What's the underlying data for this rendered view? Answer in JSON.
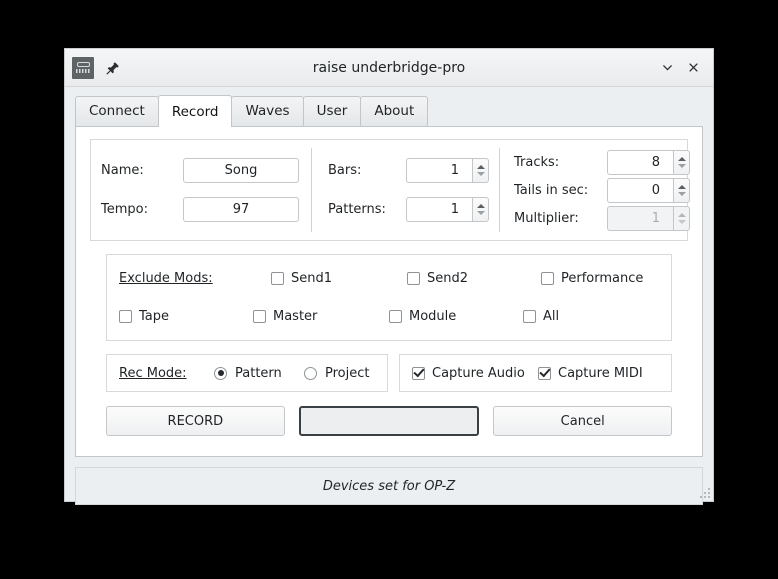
{
  "window": {
    "title": "raise underbridge-pro",
    "app_icon": "opz-device-icon",
    "pin_icon": "pin-icon",
    "minimize_icon": "chevron-down-icon",
    "close_icon": "close-icon"
  },
  "tabs": [
    {
      "label": "Connect",
      "active": false
    },
    {
      "label": "Record",
      "active": true
    },
    {
      "label": "Waves",
      "active": false
    },
    {
      "label": "User",
      "active": false
    },
    {
      "label": "About",
      "active": false
    }
  ],
  "fields": {
    "name": {
      "label": "Name:",
      "value": "Song"
    },
    "tempo": {
      "label": "Tempo:",
      "value": "97"
    },
    "bars": {
      "label": "Bars:",
      "value": "1"
    },
    "patterns": {
      "label": "Patterns:",
      "value": "1"
    },
    "tracks": {
      "label": "Tracks:",
      "value": "8"
    },
    "tails": {
      "label": "Tails in sec:",
      "value": "0"
    },
    "multiplier": {
      "label": "Multiplier:",
      "value": "1",
      "disabled": true
    }
  },
  "exclude_mods": {
    "title": "Exclude Mods:",
    "row1": [
      {
        "label": "Send1",
        "checked": false
      },
      {
        "label": "Send2",
        "checked": false
      },
      {
        "label": "Performance",
        "checked": false
      }
    ],
    "row2": [
      {
        "label": "Tape",
        "checked": false
      },
      {
        "label": "Master",
        "checked": false
      },
      {
        "label": "Module",
        "checked": false
      },
      {
        "label": "All",
        "checked": false
      }
    ]
  },
  "rec_mode": {
    "title": "Rec Mode:",
    "options": [
      {
        "label": "Pattern",
        "selected": true
      },
      {
        "label": "Project",
        "selected": false
      }
    ]
  },
  "capture": [
    {
      "label": "Capture Audio",
      "checked": true
    },
    {
      "label": "Capture  MIDI",
      "checked": true
    }
  ],
  "buttons": {
    "record": "RECORD",
    "middle": "",
    "cancel": "Cancel"
  },
  "status": {
    "text": "Devices set for OP-Z"
  },
  "colors": {
    "desktop": "#000000",
    "window_bg": "#eceff1",
    "page_bg": "#ffffff",
    "text": "#1f2326",
    "focus_border": "#3a3f43"
  }
}
